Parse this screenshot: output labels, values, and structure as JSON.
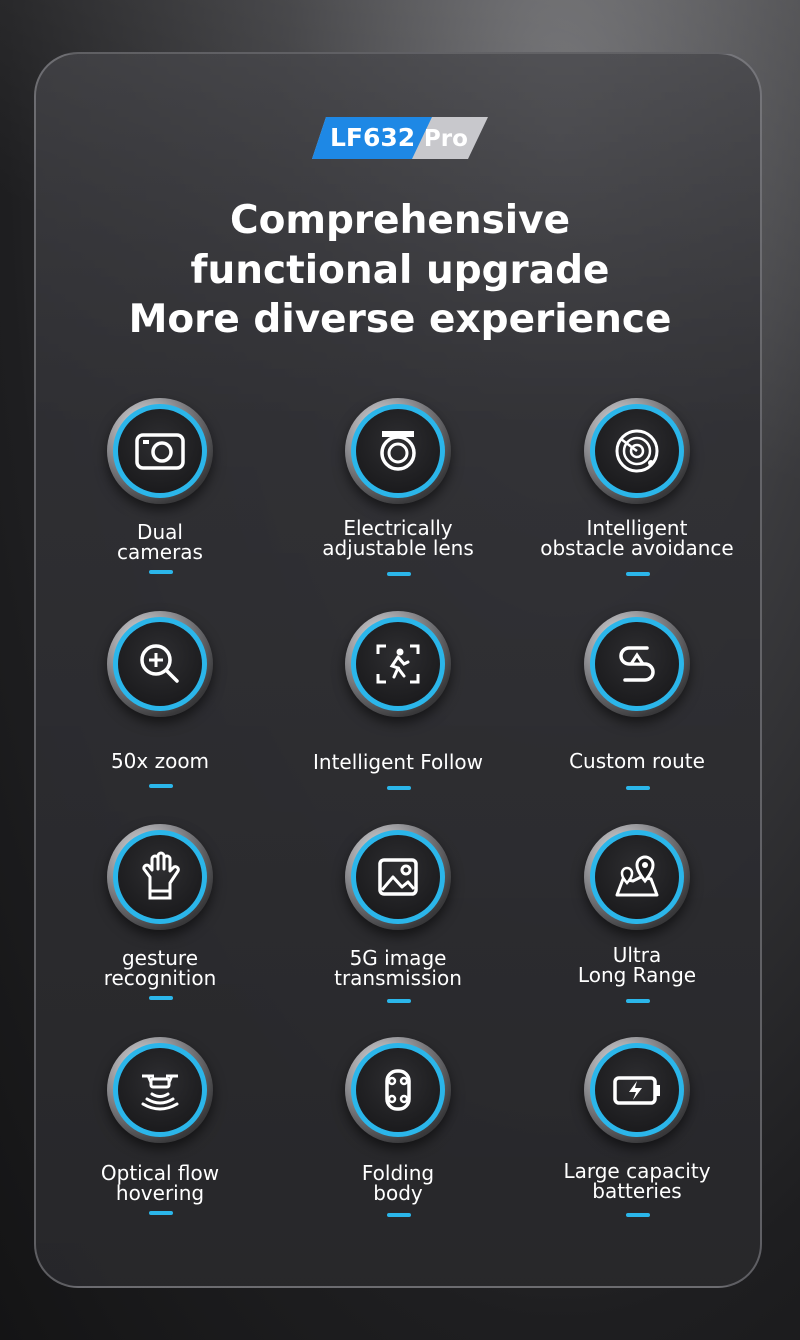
{
  "badge": {
    "model": "LF632",
    "suffix": "Pro"
  },
  "headline": {
    "line1": "Comprehensive",
    "line2": "functional upgrade",
    "line3": "More diverse experience"
  },
  "features": [
    {
      "icon": "camera-icon",
      "line1": "Dual",
      "line2": "cameras"
    },
    {
      "icon": "lens-icon",
      "line1": "Electrically",
      "line2": "adjustable lens"
    },
    {
      "icon": "radar-icon",
      "line1": "Intelligent",
      "line2": "obstacle avoidance"
    },
    {
      "icon": "zoom-icon",
      "line1": "50x zoom",
      "line2": ""
    },
    {
      "icon": "follow-icon",
      "line1": "Intelligent Follow",
      "line2": ""
    },
    {
      "icon": "route-icon",
      "line1": "Custom route",
      "line2": ""
    },
    {
      "icon": "hand-gesture-icon",
      "line1": "gesture",
      "line2": "recognition"
    },
    {
      "icon": "image-icon",
      "line1": "5G image",
      "line2": "transmission"
    },
    {
      "icon": "map-location-icon",
      "line1": "Ultra",
      "line2": "Long Range"
    },
    {
      "icon": "drone-hover-icon",
      "line1": "Optical flow",
      "line2": "hovering"
    },
    {
      "icon": "folding-body-icon",
      "line1": "Folding",
      "line2": "body"
    },
    {
      "icon": "battery-icon",
      "line1": "Large capacity",
      "line2": "batteries"
    }
  ],
  "colors": {
    "accent": "#2bb6ea",
    "badge_blue": "#1e88e5",
    "badge_grey": "#c8c8cc"
  }
}
